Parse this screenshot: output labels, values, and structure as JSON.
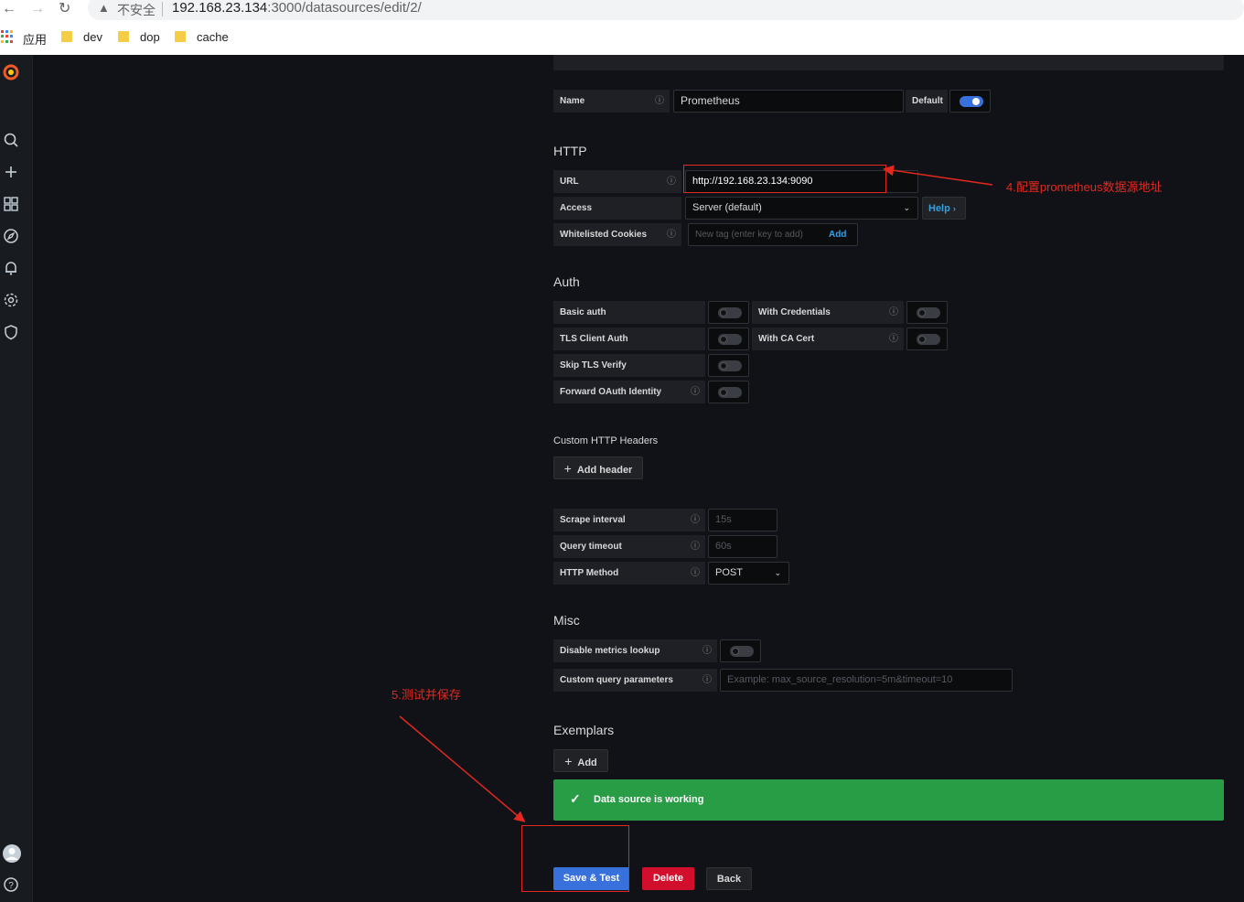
{
  "browser": {
    "insecure_label": "不安全",
    "url_host": "192.168.23.134",
    "url_path": ":3000/datasources/edit/2/",
    "bookmarks": [
      "应用",
      "dev",
      "dop",
      "cache"
    ]
  },
  "sidebar": {
    "icons": [
      "grafana-logo-icon",
      "search-icon",
      "plus-icon",
      "dashboards-icon",
      "explore-icon",
      "alerting-icon",
      "configuration-icon",
      "shield-icon",
      "avatar",
      "help-icon"
    ]
  },
  "form": {
    "name_label": "Name",
    "name_value": "Prometheus",
    "default_label": "Default",
    "default_on": true,
    "http_title": "HTTP",
    "url_label": "URL",
    "url_value": "http://192.168.23.134:9090",
    "access_label": "Access",
    "access_value": "Server (default)",
    "help_label": "Help",
    "cookies_label": "Whitelisted Cookies",
    "cookies_placeholder": "New tag (enter key to add)",
    "cookies_add": "Add",
    "auth_title": "Auth",
    "basic_auth_label": "Basic auth",
    "with_credentials_label": "With Credentials",
    "tls_client_label": "TLS Client Auth",
    "with_ca_label": "With CA Cert",
    "skip_tls_label": "Skip TLS Verify",
    "forward_oauth_label": "Forward OAuth Identity",
    "custom_headers_title": "Custom HTTP Headers",
    "add_header_label": "Add header",
    "scrape_label": "Scrape interval",
    "scrape_placeholder": "15s",
    "query_timeout_label": "Query timeout",
    "query_timeout_placeholder": "60s",
    "http_method_label": "HTTP Method",
    "http_method_value": "POST",
    "misc_title": "Misc",
    "disable_lookup_label": "Disable metrics lookup",
    "custom_query_label": "Custom query parameters",
    "custom_query_placeholder": "Example: max_source_resolution=5m&timeout=10",
    "exemplars_title": "Exemplars",
    "exemplars_add": "Add",
    "status_message": "Data source is working",
    "save_label": "Save & Test",
    "delete_label": "Delete",
    "back_label": "Back"
  },
  "annotations": {
    "step4": "4.配置prometheus数据源地址",
    "step5": "5.测试并保存"
  },
  "colors": {
    "accent_blue": "#3871dc",
    "success_green": "#299c46",
    "danger_red": "#d10e2b",
    "annotation_red": "#e2291f"
  }
}
